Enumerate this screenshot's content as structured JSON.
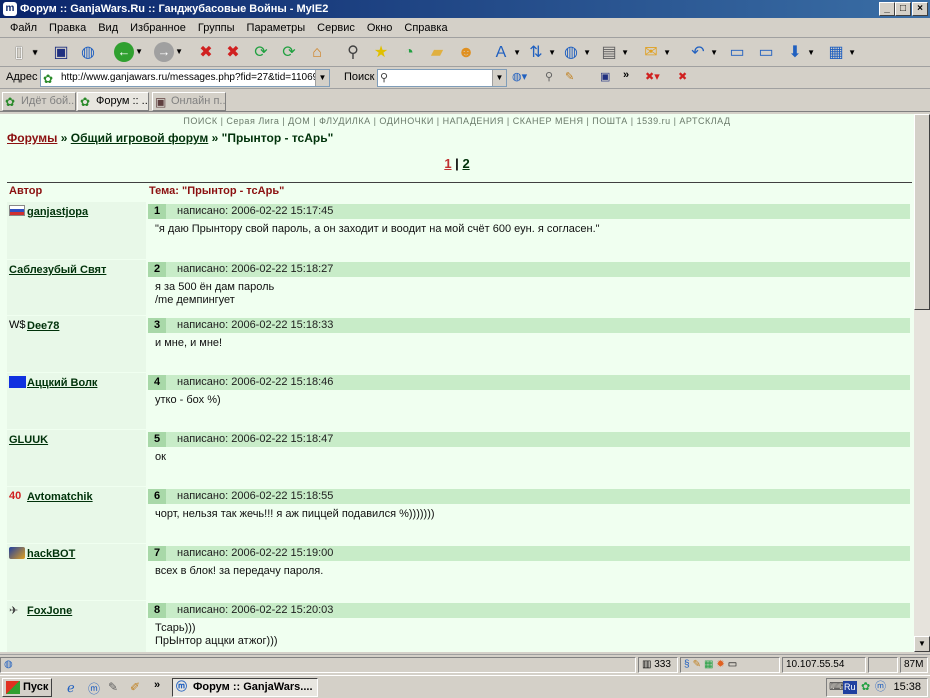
{
  "window": {
    "title": "Форум :: GanjaWars.Ru :: Ганджубасовые Войны - MyIE2"
  },
  "menu": [
    "Файл",
    "Правка",
    "Вид",
    "Избранное",
    "Группы",
    "Параметры",
    "Сервис",
    "Окно",
    "Справка"
  ],
  "address": {
    "label": "Адрес",
    "url": "http://www.ganjawars.ru/messages.php?fid=27&tid=11069"
  },
  "search": {
    "label": "Поиск"
  },
  "tabs": [
    {
      "label": "Идёт бой..."
    },
    {
      "label": "Форум :: ..."
    },
    {
      "label": "Онлайн п..."
    }
  ],
  "topnav": "ПОИСК | Серая Лига | ДОМ | ФЛУДИЛКА | ОДИНОЧКИ | НАПАДЕНИЯ | СКАНЕР МЕНЯ | ПОШТА | 1539.ru | АРТСКЛАД",
  "breadcrumb": {
    "forums": "Форумы",
    "sep1": "»",
    "section": "Общий игровой форум",
    "sep2": "»",
    "topic": "\"Прынтор - тсАрь\""
  },
  "pager": {
    "current": "1",
    "sep": "|",
    "next": "2"
  },
  "table": {
    "author_header": "Автор",
    "topic_header": "Тема: \"Прынтор - тсАрь\""
  },
  "posts": [
    {
      "author": "ganjastjopa",
      "badge": "",
      "num": "1",
      "date": "написано: 2006-02-22 15:17:45",
      "text": "\"я даю Прынтору свой пароль, а он заходит и воодит на мой счёт 600 еун. я согласен.\""
    },
    {
      "author": "Саблезубый Свят",
      "badge": "",
      "num": "2",
      "date": "написано: 2006-02-22 15:18:27",
      "text": "я за 500 ён дам пароль\n/me демпингует"
    },
    {
      "author": "Dee78",
      "badge": "W$",
      "num": "3",
      "date": "написано: 2006-02-22 15:18:33",
      "text": "и мне, и мне!"
    },
    {
      "author": "Аццкий Волк",
      "badge": "",
      "num": "4",
      "date": "написано: 2006-02-22 15:18:46",
      "text": "утко - бох %)"
    },
    {
      "author": "GLUUK",
      "badge": "",
      "num": "5",
      "date": "написано: 2006-02-22 15:18:47",
      "text": "ок"
    },
    {
      "author": "Avtomatchik",
      "badge": "40",
      "num": "6",
      "date": "написано: 2006-02-22 15:18:55",
      "text": "чорт, нельзя так жечь!!! я аж пиццей подавился %)))))))"
    },
    {
      "author": "hackBOT",
      "badge": "",
      "num": "7",
      "date": "написано: 2006-02-22 15:19:00",
      "text": "всех в блок! за передачу пароля."
    },
    {
      "author": "FoxJone",
      "badge": "",
      "num": "8",
      "date": "написано: 2006-02-22 15:20:03",
      "text": "Тсарь)))\nПрЫнтор аццки атжог)))"
    }
  ],
  "status": {
    "count": "333",
    "ip": "10.107.55.54",
    "mem": "87M"
  },
  "taskbar": {
    "start": "Пуск",
    "task": "Форум :: GanjaWars....",
    "lang": "Ru",
    "clock": "15:38"
  }
}
